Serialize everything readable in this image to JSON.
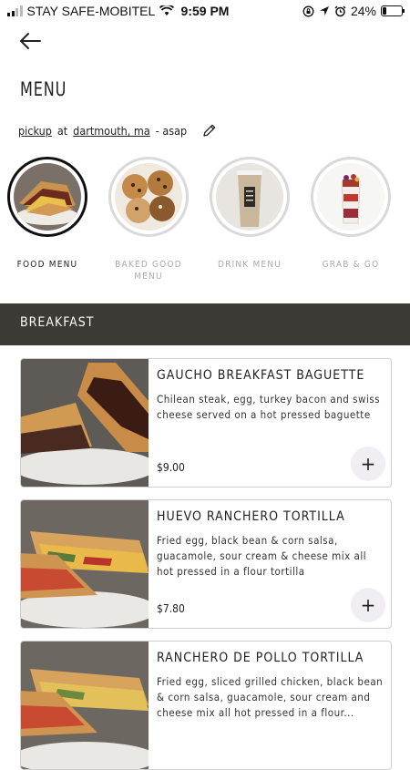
{
  "status_bar": {
    "carrier": "STAY SAFE-MOBITEL",
    "time": "9:59 PM",
    "battery": "24%",
    "battery_level": 0.24
  },
  "header": {
    "title": "MENU"
  },
  "order": {
    "mode": "pickup",
    "at": "at",
    "location": "dartmouth, ma",
    "timing": "- asap"
  },
  "categories": [
    {
      "label": "FOOD MENU",
      "active": true
    },
    {
      "label": "BAKED GOOD MENU",
      "active": false
    },
    {
      "label": "DRINK MENU",
      "active": false
    },
    {
      "label": "GRAB & GO",
      "active": false
    }
  ],
  "section": {
    "title": "BREAKFAST"
  },
  "items": [
    {
      "name": "GAUCHO BREAKFAST BAGUETTE",
      "description": "Chilean steak, egg, turkey bacon and swiss cheese served on a hot pressed baguette",
      "price": "$9.00"
    },
    {
      "name": "HUEVO RANCHERO TORTILLA",
      "description": "Fried egg, black bean & corn salsa, guacamole, sour cream & cheese mix all hot pressed in a flour tortilla",
      "price": "$7.80"
    },
    {
      "name": "RANCHERO DE POLLO TORTILLA",
      "description": "Fried egg, sliced grilled chicken, black bean & corn salsa, guacamole, sour cream and cheese mix all hot pressed in a flour...",
      "price": ""
    }
  ],
  "add_symbol": "+"
}
